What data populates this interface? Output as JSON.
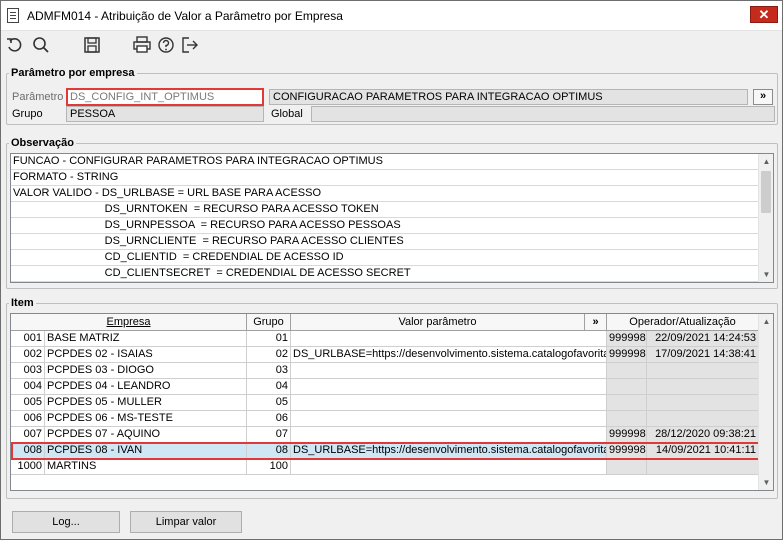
{
  "window": {
    "title": "ADMFM014 - Atribuição de Valor a Parâmetro por Empresa",
    "close_glyph": "✕"
  },
  "toolbar": {
    "icons": [
      "undo-icon",
      "search-icon",
      "save-icon",
      "print-icon",
      "help-icon",
      "exit-icon"
    ]
  },
  "parametro_section": {
    "legend": "Parâmetro por empresa",
    "parametro_label": "Parâmetro",
    "parametro_value": "DS_CONFIG_INT_OPTIMUS",
    "parametro_desc": "CONFIGURACAO PARAMETROS PARA INTEGRACAO OPTIMUS",
    "more_button": "»",
    "grupo_label": "Grupo",
    "grupo_value": "PESSOA",
    "global_label": "Global",
    "global_value": ""
  },
  "observacao": {
    "legend": "Observação",
    "lines": [
      "FUNCAO - CONFIGURAR PARAMETROS PARA INTEGRACAO OPTIMUS",
      "FORMATO - STRING",
      "VALOR VALIDO - DS_URLBASE = URL BASE PARA ACESSO",
      "                              DS_URNTOKEN  = RECURSO PARA ACESSO TOKEN",
      "                              DS_URNPESSOA  = RECURSO PARA ACESSO PESSOAS",
      "                              DS_URNCLIENTE  = RECURSO PARA ACESSO CLIENTES",
      "                              CD_CLIENTID  = CREDENDIAL DE ACESSO ID",
      "                              CD_CLIENTSECRET  = CREDENDIAL DE ACESSO SECRET"
    ]
  },
  "item": {
    "legend": "Item",
    "columns": {
      "empresa": "Empresa",
      "grupo": "Grupo",
      "valor": "Valor parâmetro",
      "expand": "»",
      "operador": "Operador/Atualização"
    },
    "rows": [
      {
        "code": "001",
        "empresa": "BASE MATRIZ",
        "grupo": "01",
        "valor": "",
        "operador": "999998",
        "data": "22/09/2021 14:24:53"
      },
      {
        "code": "002",
        "empresa": "PCPDES 02 - ISAIAS",
        "grupo": "02",
        "valor": "DS_URLBASE=https://desenvolvimento.sistema.catalogofavorita.",
        "operador": "999998",
        "data": "17/09/2021 14:38:41"
      },
      {
        "code": "003",
        "empresa": "PCPDES 03 - DIOGO",
        "grupo": "03",
        "valor": "",
        "operador": "",
        "data": ""
      },
      {
        "code": "004",
        "empresa": "PCPDES 04 - LEANDRO",
        "grupo": "04",
        "valor": "",
        "operador": "",
        "data": ""
      },
      {
        "code": "005",
        "empresa": "PCPDES 05 - MULLER",
        "grupo": "05",
        "valor": "",
        "operador": "",
        "data": ""
      },
      {
        "code": "006",
        "empresa": "PCPDES 06 - MS-TESTE",
        "grupo": "06",
        "valor": "",
        "operador": "",
        "data": ""
      },
      {
        "code": "007",
        "empresa": "PCPDES 07 - AQUINO",
        "grupo": "07",
        "valor": "",
        "operador": "999998",
        "data": "28/12/2020 09:38:21"
      },
      {
        "code": "008",
        "empresa": "PCPDES 08 - IVAN",
        "grupo": "08",
        "valor": "DS_URLBASE=https://desenvolvimento.sistema.catalogofavorita.",
        "operador": "999998",
        "data": "14/09/2021 10:41:11"
      },
      {
        "code": "1000",
        "empresa": "MARTINS",
        "grupo": "100",
        "valor": "",
        "operador": "",
        "data": ""
      }
    ]
  },
  "buttons": {
    "log": "Log...",
    "limpar": "Limpar valor"
  },
  "colors": {
    "highlight": "#e0393a",
    "selected_row": "#cfe6f5",
    "close": "#c42b1c"
  }
}
